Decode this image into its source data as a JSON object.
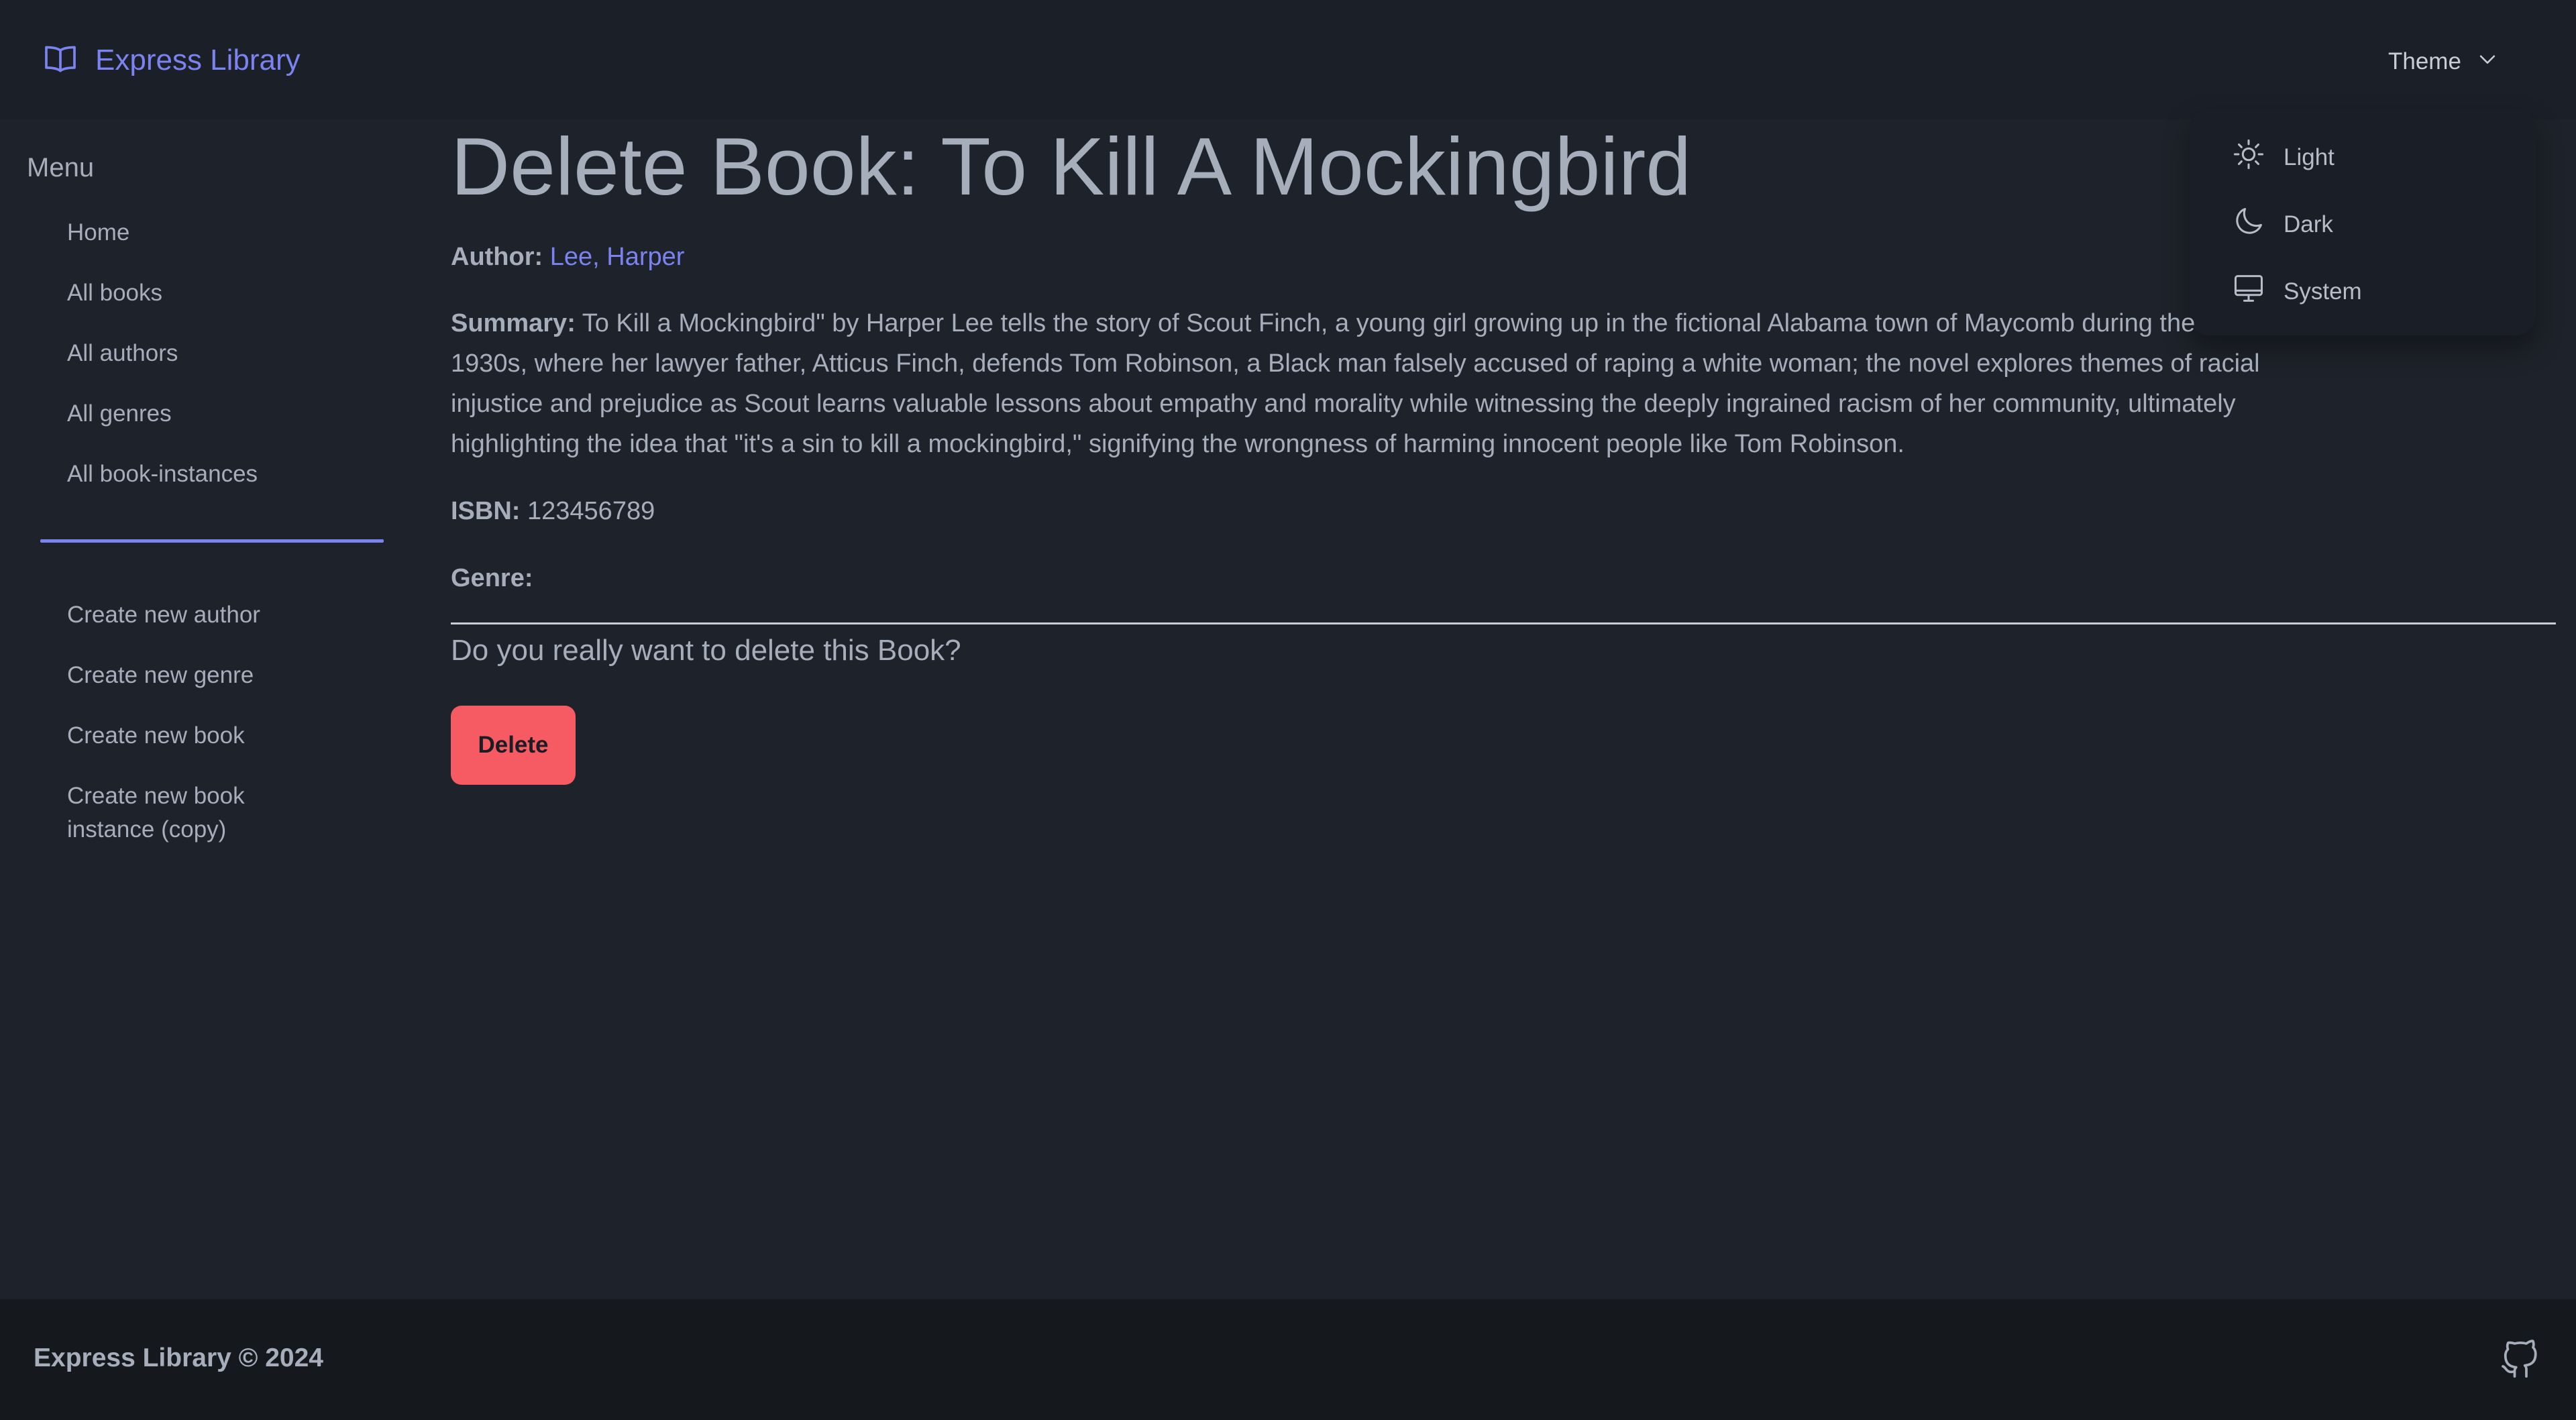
{
  "navbar": {
    "brand": "Express Library",
    "theme_label": "Theme",
    "theme_options": [
      {
        "label": "Light",
        "icon": "sun-icon"
      },
      {
        "label": "Dark",
        "icon": "moon-icon"
      },
      {
        "label": "System",
        "icon": "monitor-icon"
      }
    ]
  },
  "sidebar": {
    "title": "Menu",
    "browse_links": [
      "Home",
      "All books",
      "All authors",
      "All genres",
      "All book-instances"
    ],
    "create_links": [
      "Create new author",
      "Create new genre",
      "Create new book",
      "Create new book instance (copy)"
    ]
  },
  "main": {
    "title": "Delete Book: To Kill A Mockingbird",
    "author_label": "Author:",
    "author_value": "Lee, Harper",
    "summary_label": "Summary:",
    "summary_value": "To Kill a Mockingbird\" by Harper Lee tells the story of Scout Finch, a young girl growing up in the fictional Alabama town of Maycomb during the 1930s, where her lawyer father, Atticus Finch, defends Tom Robinson, a Black man falsely accused of raping a white woman; the novel explores themes of racial injustice and prejudice as Scout learns valuable lessons about empathy and morality while witnessing the deeply ingrained racism of her community, ultimately highlighting the idea that \"it's a sin to kill a mockingbird,\" signifying the wrongness of harming innocent people like Tom Robinson.",
    "isbn_label": "ISBN:",
    "isbn_value": "123456789",
    "genre_label": "Genre:",
    "confirm_question": "Do you really want to delete this Book?",
    "delete_label": "Delete"
  },
  "footer": {
    "text": "Express Library © 2024",
    "icon": "github-icon"
  },
  "colors": {
    "background": "#1e222a",
    "navbar": "#1b1f27",
    "footer": "#15181d",
    "accent": "#7b83f0",
    "danger": "#f65a62",
    "text": "#a6adbb"
  }
}
